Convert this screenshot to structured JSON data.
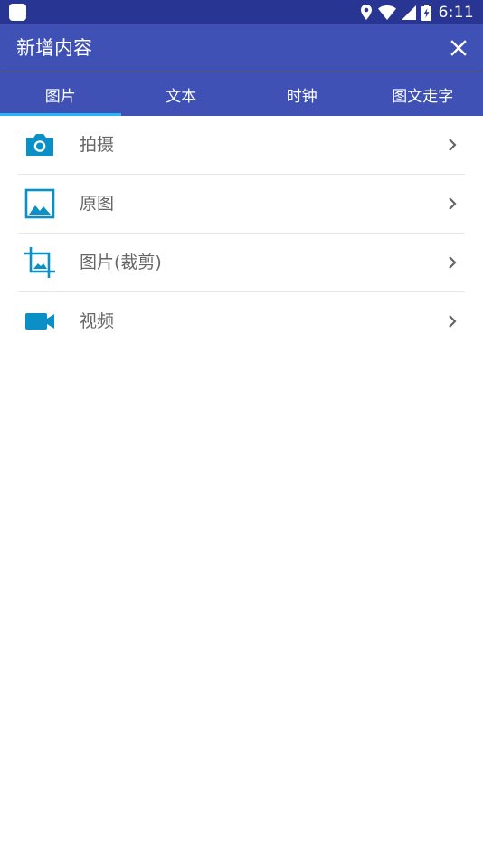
{
  "status_bar": {
    "time": "6:11",
    "icons": [
      "app-notification-icon",
      "location-icon",
      "wifi-icon",
      "cell-signal-icon",
      "battery-charging-icon"
    ]
  },
  "app_bar": {
    "title": "新增内容",
    "close_icon": "close-icon"
  },
  "tabs": [
    {
      "label": "图片",
      "active": true
    },
    {
      "label": "文本",
      "active": false
    },
    {
      "label": "时钟",
      "active": false
    },
    {
      "label": "图文走字",
      "active": false
    }
  ],
  "items": [
    {
      "label": "拍摄",
      "icon": "camera-icon"
    },
    {
      "label": "原图",
      "icon": "image-icon"
    },
    {
      "label": "图片(裁剪)",
      "icon": "crop-icon"
    },
    {
      "label": "视频",
      "icon": "video-icon"
    }
  ],
  "colors": {
    "status_bar": "#283593",
    "app_bar": "#3f51b5",
    "tab_indicator": "#29b6f6",
    "icon_accent": "#0a8fc7",
    "item_text": "#666666",
    "divider": "#e6e6e6"
  }
}
